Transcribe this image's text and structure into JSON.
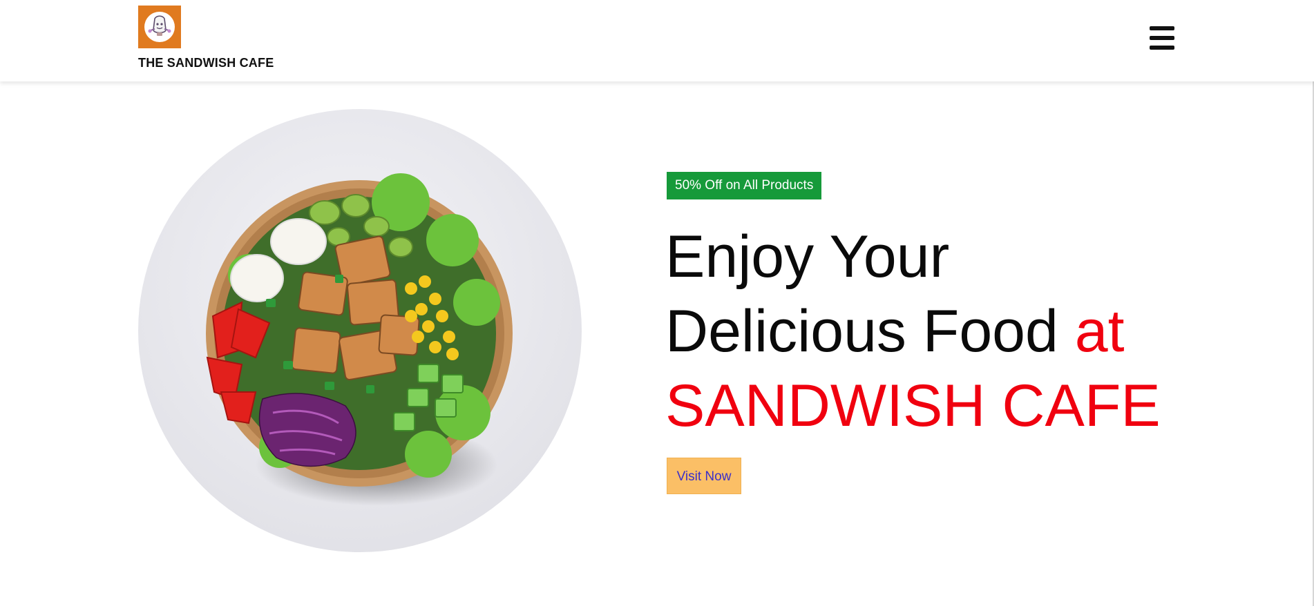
{
  "header": {
    "brand_name": "THE SANDWISH CAFE",
    "logo_icon": "cafe-logo-icon",
    "menu_icon": "hamburger-menu-icon"
  },
  "hero": {
    "image": "salad-bowl-photo",
    "offer_badge": "50% Off on All Products",
    "headline_line1": "Enjoy Your",
    "headline_line2": "Delicious Food ",
    "headline_line2_accent": "at",
    "headline_line3": "SANDWISH CAFE",
    "cta_label": "Visit Now"
  },
  "colors": {
    "accent_red": "#f0000f",
    "badge_green": "#169a3a",
    "button_yellow": "#fbbf66",
    "button_text": "#3b2fc9",
    "logo_orange": "#e07a1f"
  }
}
